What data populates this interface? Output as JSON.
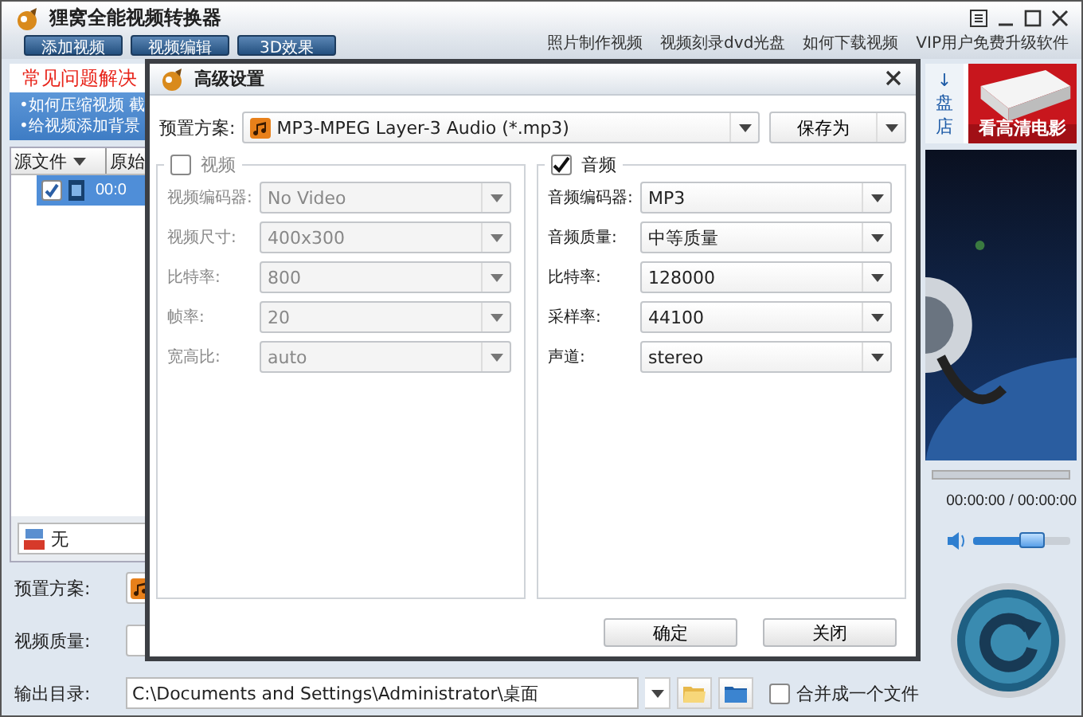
{
  "app": {
    "title": "狸窝全能视频转换器"
  },
  "toolbar": {
    "buttons": [
      "添加视频",
      "视频编辑",
      "3D效果"
    ],
    "links": [
      "照片制作视频",
      "视频刻录dvd光盘",
      "如何下载视频",
      "VIP用户免费升级软件"
    ]
  },
  "faq": {
    "title": "常见问题解决",
    "links": [
      "•如何压缩视频  截",
      "•给视频添加背景"
    ]
  },
  "file_list": {
    "columns": [
      "源文件",
      "原始"
    ],
    "rows": [
      {
        "selected": true,
        "checked": true,
        "duration": "00:0"
      }
    ]
  },
  "subtitle": {
    "value": "无"
  },
  "promo": {
    "arrow": "↓",
    "line_1": "盘",
    "line_2": "店",
    "ad": "看高清电影"
  },
  "preview": {
    "time": "00:00:00 / 00:00:00",
    "progress": {
      "level": 0
    },
    "volume": {
      "level": 0.6
    }
  },
  "bottom": {
    "preset_label": "预置方案:",
    "quality_label": "视频质量:",
    "output_label": "输出目录:",
    "output_path": "C:\\Documents and Settings\\Administrator\\桌面",
    "merge": {
      "label": "合并成一个文件",
      "checked": false
    }
  },
  "dialog": {
    "title": "高级设置",
    "preset_label": "预置方案:",
    "preset": "MP3-MPEG Layer-3 Audio (*.mp3)",
    "save_as": "保存为",
    "groups": [
      {
        "title": "视频",
        "checked": false,
        "fields": [
          {
            "label": "视频编码器:",
            "value": "No Video"
          },
          {
            "label": "视频尺寸:",
            "value": "400x300"
          },
          {
            "label": "比特率:",
            "value": "800"
          },
          {
            "label": "帧率:",
            "value": "20"
          },
          {
            "label": "宽高比:",
            "value": "auto"
          }
        ]
      },
      {
        "title": "音频",
        "checked": true,
        "fields": [
          {
            "label": "音频编码器:",
            "value": "MP3"
          },
          {
            "label": "音频质量:",
            "value": "中等质量"
          },
          {
            "label": "比特率:",
            "value": "128000"
          },
          {
            "label": "采样率:",
            "value": "44100"
          },
          {
            "label": "声道:",
            "value": "stereo"
          }
        ]
      }
    ],
    "buttons": [
      "确定",
      "关闭"
    ]
  }
}
